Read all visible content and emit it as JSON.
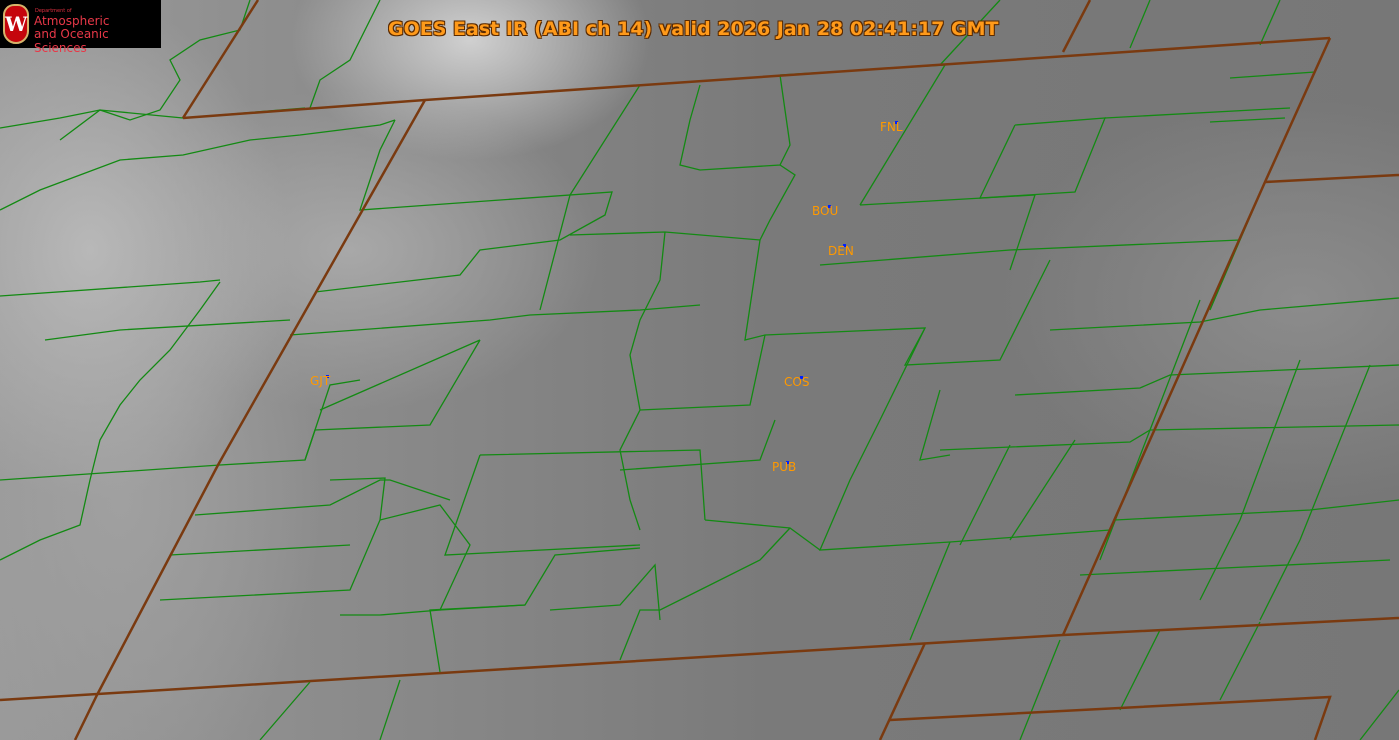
{
  "title": "GOES East IR (ABI ch 14) valid 2026 Jan 28 02:41:17 GMT",
  "logo": {
    "dept": "Department of",
    "line1": "Atmospheric",
    "line2": "and Oceanic Sciences",
    "letter": "W"
  },
  "stations": [
    {
      "id": "FNL"
    },
    {
      "id": "BOU"
    },
    {
      "id": "DEN"
    },
    {
      "id": "GJT"
    },
    {
      "id": "COS"
    },
    {
      "id": "PUB"
    }
  ],
  "colors": {
    "state_border": "#7a3a10",
    "county_border": "#1a7a1a",
    "station_label": "#ff9900",
    "station_dot": "#0020ff"
  }
}
